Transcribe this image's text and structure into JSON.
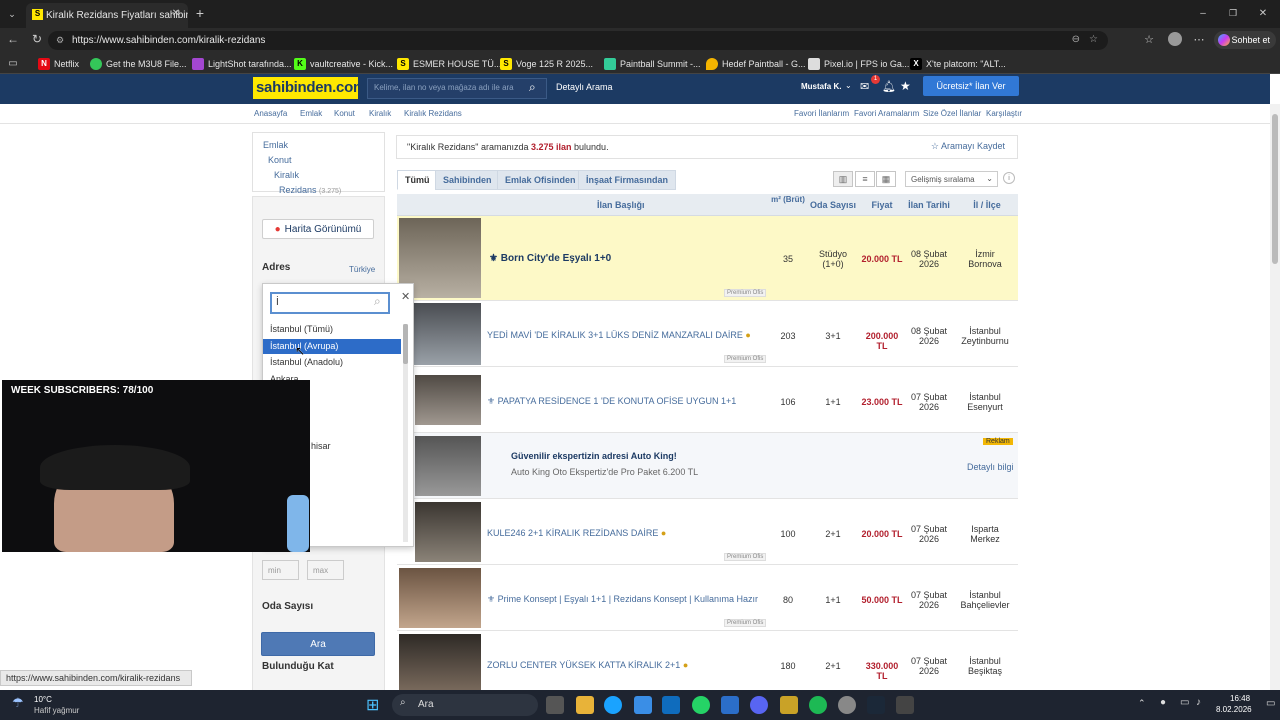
{
  "browser": {
    "tab_title": "Kiralık Rezidans Fiyatları sahibinden",
    "url": "https://www.sahibinden.com/kiralik-rezidans",
    "profile_action": "Sohbet et"
  },
  "bookmarks": [
    "Netflix",
    "Get the M3U8 File...",
    "LightShot tarafında...",
    "vaultcreative - Kick...",
    "ESMER HOUSE TÜ...",
    "Voge 125 R 2025...",
    "Paintball Summit -...",
    "Hedef Paintball - G...",
    "Pixel.io | FPS io Ga...",
    "X'te platcom: \"ALT..."
  ],
  "header": {
    "logo": "sahibinden.com",
    "search_placeholder": "Kelime, ilan no veya mağaza adı ile ara",
    "detailed_search": "Detaylı Arama",
    "user": "Mustafa K.",
    "notif_count": "1",
    "post_button": "Ücretsiz* İlan Ver"
  },
  "breadcrumb": [
    "Anasayfa",
    "Emlak",
    "Konut",
    "Kiralık",
    "Kiralık Rezidans"
  ],
  "top_links": [
    "Favori İlanlarım",
    "Favori Aramalarım",
    "Size Özel İlanlar",
    "Karşılaştır"
  ],
  "sidebar": {
    "categories": [
      "Emlak",
      "Konut",
      "Kiralık",
      "Rezidans"
    ],
    "rezidans_count": "(3.275)",
    "map_button": "Harita Görünümü",
    "address_label": "Adres",
    "address_country": "Türkiye",
    "min_placeholder": "min",
    "max_placeholder": "max",
    "rooms_label": "Oda Sayısı",
    "floor_label": "Bulunduğu Kat",
    "search_button": "Ara"
  },
  "dropdown": {
    "search_value": "İ",
    "options": [
      "İstanbul (Tümü)",
      "İstanbul (Avrupa)",
      "İstanbul (Anadolu)",
      "Ankara",
      "hisar"
    ],
    "selected_index": 1
  },
  "stream": {
    "subscribers": "WEEK SUBSCRIBERS: 78/100"
  },
  "results": {
    "query": "\"Kiralık Rezidans\"",
    "mid": "aramanızda",
    "count": "3.275 ilan",
    "suffix": "bulundu.",
    "save": "Aramayı Kaydet"
  },
  "tabs": [
    "Tümü",
    "Sahibinden",
    "Emlak Ofisinden",
    "İnşaat Firmasından"
  ],
  "sort": "Gelişmiş sıralama",
  "columns": [
    "İlan Başlığı",
    "m² (Brüt)",
    "Oda Sayısı",
    "Fiyat",
    "İlan Tarihi",
    "İl / İlçe"
  ],
  "listings": [
    {
      "title": "Born City'de Eşyalı 1+0",
      "m2": "35",
      "rooms": "Stüdyo (1+0)",
      "price": "20.000 TL",
      "date": "08 Şubat 2026",
      "loc": "İzmir Bornova",
      "badge": "Premium Ofis"
    },
    {
      "title": "YEDİ MAVİ 'DE KİRALIK 3+1 LÜKS DENİZ MANZARALI DAİRE",
      "m2": "203",
      "rooms": "3+1",
      "price": "200.000 TL",
      "date": "08 Şubat 2026",
      "loc": "İstanbul Zeytinburnu",
      "badge": "Premium Ofis"
    },
    {
      "title": "PAPATYA RESİDENCE 1 'DE KONUTA OFİSE UYGUN 1+1",
      "m2": "106",
      "rooms": "1+1",
      "price": "23.000 TL",
      "date": "07 Şubat 2026",
      "loc": "İstanbul Esenyurt",
      "badge": ""
    },
    {
      "title": "KULE246 2+1 KİRALIK REZİDANS DAİRE",
      "m2": "100",
      "rooms": "2+1",
      "price": "20.000 TL",
      "date": "07 Şubat 2026",
      "loc": "Isparta Merkez",
      "badge": "Premium Ofis"
    },
    {
      "title": "Prime Konsept | Eşyalı 1+1 | Rezidans Konsept | Kullanıma Hazır",
      "m2": "80",
      "rooms": "1+1",
      "price": "50.000 TL",
      "date": "07 Şubat 2026",
      "loc": "İstanbul Bahçelievler",
      "badge": "Premium Ofis"
    },
    {
      "title": "ZORLU CENTER YÜKSEK KATTA KİRALIK 2+1",
      "m2": "180",
      "rooms": "2+1",
      "price": "330.000 TL",
      "date": "07 Şubat 2026",
      "loc": "İstanbul Beşiktaş",
      "badge": ""
    }
  ],
  "ad": {
    "title": "Güvenilir ekspertizin adresi Auto King!",
    "text": "Auto King Oto Ekspertiz'de Pro Paket 6.200 TL",
    "label": "Reklam",
    "link": "Detaylı bilgi"
  },
  "status_url": "https://www.sahibinden.com/kiralik-rezidans",
  "taskbar": {
    "temp": "10°C",
    "weather": "Hafif yağmur",
    "search": "Ara",
    "time": "16:48",
    "date": "8.02.2026"
  }
}
